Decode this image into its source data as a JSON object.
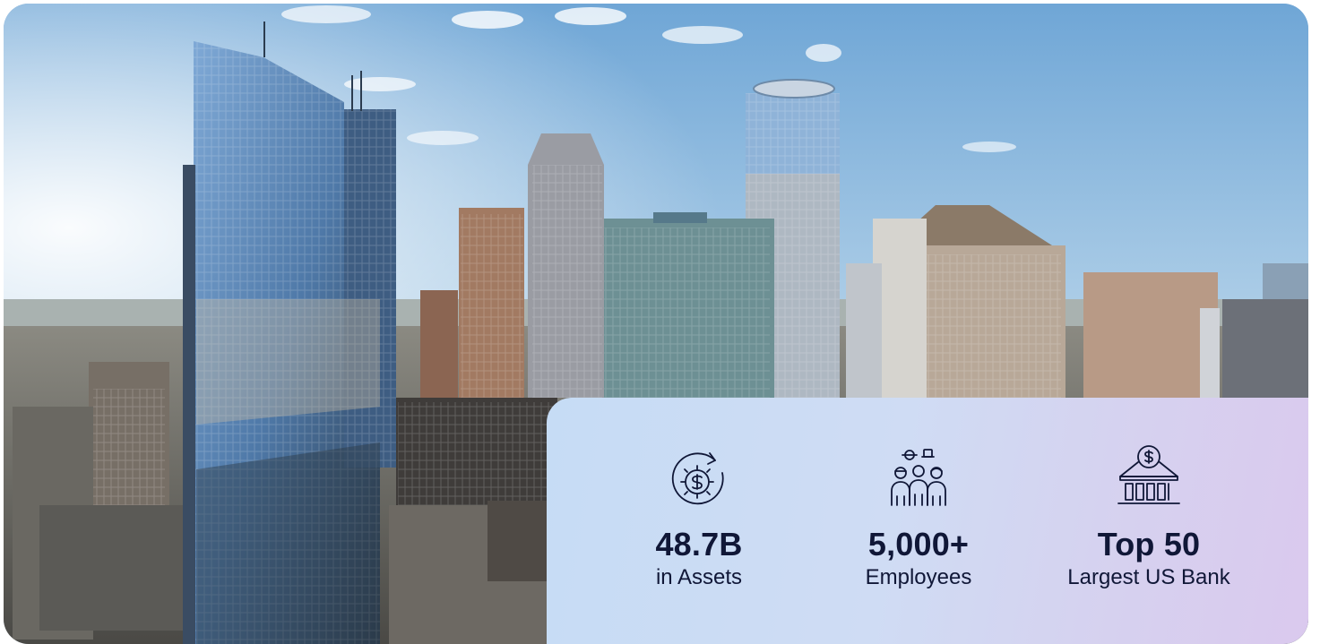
{
  "hero": {
    "image_alt": "Downtown city skyline with glass skyscrapers"
  },
  "stats": [
    {
      "icon": "dollar-cycle-icon",
      "value": "48.7B",
      "label": "in Assets"
    },
    {
      "icon": "people-group-icon",
      "value": "5,000+",
      "label": "Employees"
    },
    {
      "icon": "bank-icon",
      "value": "Top 50",
      "label": "Largest US Bank"
    }
  ],
  "colors": {
    "text": "#101737",
    "panel_start": "#c6dcf5",
    "panel_end": "#dac9ee"
  }
}
